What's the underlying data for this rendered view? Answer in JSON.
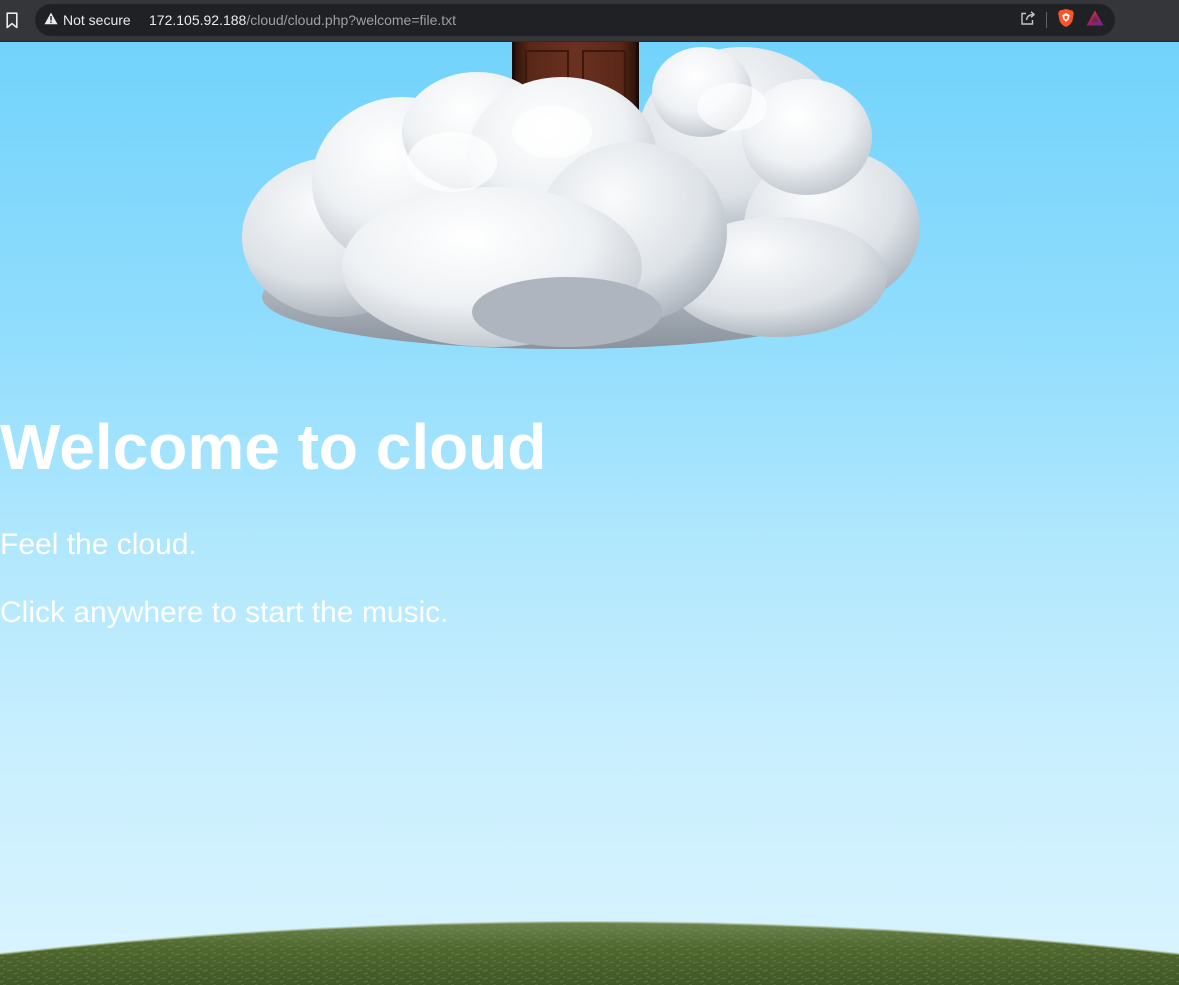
{
  "browser": {
    "security_label": "Not secure",
    "url_host": "172.105.92.188",
    "url_path": "/cloud/cloud.php?welcome=file.txt",
    "icons": [
      "bookmark-icon",
      "warning-icon",
      "share-icon",
      "brave-shield-icon",
      "brave-rewards-icon"
    ]
  },
  "page": {
    "title": "Welcome to cloud",
    "tagline": "Feel the cloud.",
    "instruction": "Click anywhere to start the music."
  },
  "colors": {
    "sky_top": "#72d3fb",
    "sky_bottom": "#d9f4ff",
    "text": "#ffffff",
    "grass": "#4f6b35",
    "brave_orange": "#fb542b"
  }
}
